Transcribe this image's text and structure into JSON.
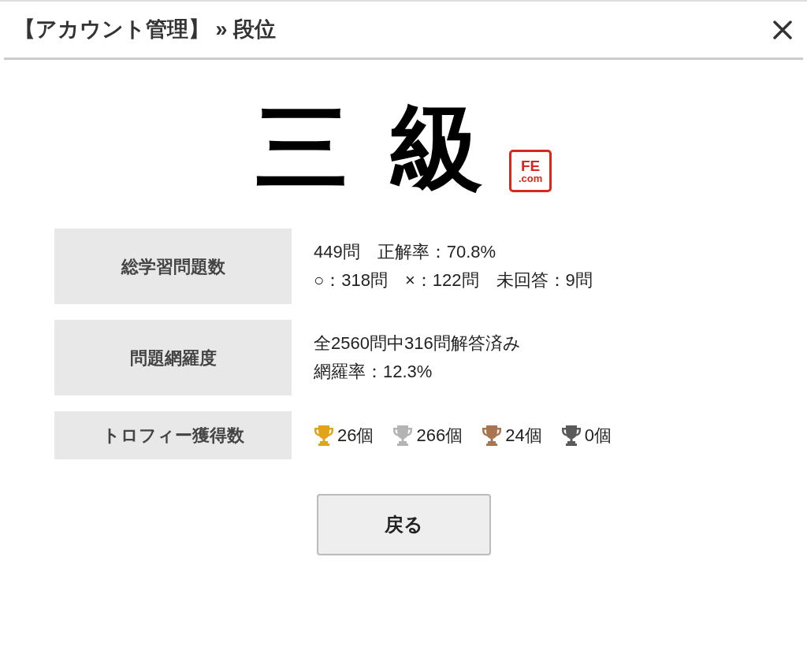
{
  "header": {
    "title": "【アカウント管理】 » 段位"
  },
  "rank": {
    "text": "三級",
    "stamp": [
      "FE",
      ".com"
    ]
  },
  "stats": [
    {
      "kind": "text",
      "label": "総学習問題数",
      "lines": [
        "449問　正解率：70.8%",
        "○：318問　×：122問　未回答：9問"
      ]
    },
    {
      "kind": "text",
      "label": "問題網羅度",
      "lines": [
        "全2560問中316問解答済み",
        "網羅率：12.3%"
      ]
    },
    {
      "kind": "trophies",
      "label": "トロフィー獲得数",
      "trophies": [
        {
          "color": "#e0a31a",
          "count": "26個"
        },
        {
          "color": "#b4b4b4",
          "count": "266個"
        },
        {
          "color": "#a87550",
          "count": "24個"
        },
        {
          "color": "#5a5a5a",
          "count": "0個"
        }
      ]
    }
  ],
  "buttons": [
    "戻る"
  ]
}
